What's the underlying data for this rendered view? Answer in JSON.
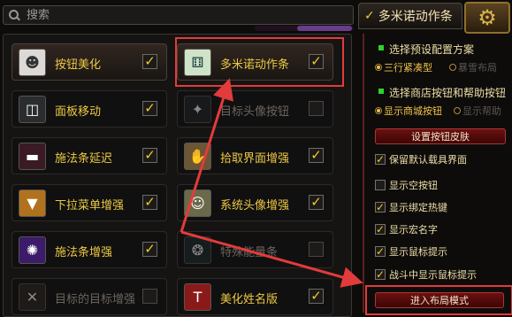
{
  "search": {
    "placeholder": "搜索"
  },
  "tab": {
    "label": "多米诺动作条"
  },
  "modules": [
    {
      "label": "按钮美化",
      "checked": true,
      "icon": "mask-icon"
    },
    {
      "label": "多米诺动作条",
      "checked": true,
      "icon": "domino-icon"
    },
    {
      "label": "面板移动",
      "checked": true,
      "icon": "move-icon"
    },
    {
      "label": "目标头像按钮",
      "checked": false,
      "icon": "target-icon"
    },
    {
      "label": "施法条延迟",
      "checked": true,
      "icon": "castbar-icon"
    },
    {
      "label": "拾取界面增强",
      "checked": true,
      "icon": "loot-icon"
    },
    {
      "label": "下拉菜单增强",
      "checked": true,
      "icon": "dropdown-icon"
    },
    {
      "label": "系统头像增强",
      "checked": true,
      "icon": "portrait-icon"
    },
    {
      "label": "施法条增强",
      "checked": true,
      "icon": "spell-icon"
    },
    {
      "label": "特殊能量条",
      "checked": false,
      "icon": "energy-icon"
    },
    {
      "label": "目标的目标增强",
      "checked": false,
      "icon": "tot-icon"
    },
    {
      "label": "美化姓名版",
      "checked": true,
      "icon": "nameplate-icon"
    }
  ],
  "settings": {
    "preset_title": "选择预设配置方案",
    "preset_opt1": "三行紧凑型",
    "preset_opt2": "暴雪布局",
    "shop_title": "选择商店按钮和帮助按钮",
    "shop_opt1": "显示商城按钮",
    "shop_opt2": "显示帮助",
    "skin_button": "设置按钮皮肤",
    "options": [
      {
        "label": "保留默认载具界面",
        "checked": true
      },
      {
        "label": "显示空按钮",
        "checked": false
      },
      {
        "label": "显示绑定热键",
        "checked": true
      },
      {
        "label": "显示宏名字",
        "checked": true
      },
      {
        "label": "显示鼠标提示",
        "checked": true
      },
      {
        "label": "战斗中显示鼠标提示",
        "checked": true
      }
    ],
    "layout_button": "进入布局模式"
  },
  "colors": {
    "accent": "#f0c83c",
    "highlight": "#e23b3b",
    "button_red": "#6d1010"
  }
}
